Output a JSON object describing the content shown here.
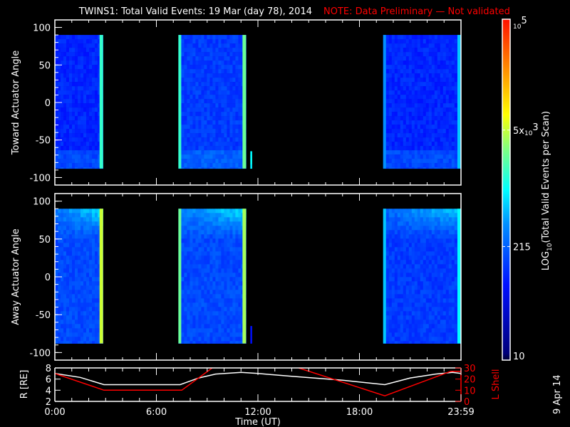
{
  "title": "TWINS1: Total Valid Events: 19 Mar (day  78), 2014",
  "note": "NOTE: Data Preliminary — Not validated",
  "date_stamp": "9 Apr 14",
  "colors": {
    "note": "#ff0000",
    "r_line": "#ffffff",
    "l_line": "#ff0000"
  },
  "chart_data": [
    {
      "type": "heatmap",
      "name": "toward",
      "ylabel": "Toward Actuator Angle",
      "ylim": [
        -110,
        110
      ],
      "yticks": [
        "100",
        "50",
        "0",
        "-50",
        "-100"
      ],
      "ytick_values": [
        100,
        50,
        0,
        -50,
        -100
      ],
      "xlim": [
        0,
        24
      ],
      "blocks": [
        {
          "t0": 0.0,
          "t1": 2.85,
          "a0": -88,
          "a1": 90,
          "level": 0.25,
          "edge_level": 0.55
        },
        {
          "t0": 7.3,
          "t1": 11.3,
          "a0": -88,
          "a1": 90,
          "level": 0.28,
          "edge_level": 0.6
        },
        {
          "t0": 11.55,
          "t1": 11.65,
          "a0": -88,
          "a1": -65,
          "level": 0.45,
          "edge_level": 0.45
        },
        {
          "t0": 19.4,
          "t1": 24.0,
          "a0": -88,
          "a1": 90,
          "level": 0.25,
          "edge_level": 0.45
        }
      ]
    },
    {
      "type": "heatmap",
      "name": "away",
      "ylabel": "Away Actuator Angle",
      "ylim": [
        -110,
        110
      ],
      "yticks": [
        "100",
        "50",
        "0",
        "-50",
        "-100"
      ],
      "ytick_values": [
        100,
        50,
        0,
        -50,
        -100
      ],
      "xlim": [
        0,
        24
      ],
      "blocks": [
        {
          "t0": 0.0,
          "t1": 2.85,
          "a0": -88,
          "a1": 90,
          "level": 0.3,
          "edge_level": 0.68
        },
        {
          "t0": 7.3,
          "t1": 11.3,
          "a0": -88,
          "a1": 90,
          "level": 0.3,
          "edge_level": 0.65
        },
        {
          "t0": 11.55,
          "t1": 11.65,
          "a0": -88,
          "a1": -65,
          "level": 0.15,
          "edge_level": 0.15
        },
        {
          "t0": 19.4,
          "t1": 24.0,
          "a0": -88,
          "a1": 90,
          "level": 0.28,
          "edge_level": 0.5
        }
      ]
    },
    {
      "type": "line",
      "name": "orbit",
      "xlabel": "Time (UT)",
      "ylabel": "R [RE]",
      "y2label": "L Shell",
      "xlim": [
        0,
        24
      ],
      "ylim": [
        2,
        8
      ],
      "y2lim": [
        0,
        30
      ],
      "xticks": [
        "0:00",
        "6:00",
        "12:00",
        "18:00",
        "23:59"
      ],
      "xtick_values": [
        0,
        6,
        12,
        18,
        24
      ],
      "yticks": [
        "8",
        "6",
        "4",
        "2"
      ],
      "ytick_values": [
        8,
        6,
        4,
        2
      ],
      "y2ticks": [
        "30",
        "20",
        "10",
        "0"
      ],
      "y2tick_values": [
        30,
        20,
        10,
        0
      ],
      "series": [
        {
          "name": "R",
          "axis": "left",
          "x": [
            0,
            1.5,
            2.9,
            7.4,
            8.5,
            9.5,
            11.0,
            12.0,
            14.0,
            17.0,
            19.5,
            21.0,
            22.5,
            23.5,
            24.0
          ],
          "y": [
            7.0,
            6.3,
            5.0,
            5.0,
            6.2,
            6.9,
            7.2,
            7.0,
            6.5,
            5.8,
            5.0,
            6.2,
            6.9,
            7.2,
            7.0
          ]
        },
        {
          "name": "L Shell",
          "axis": "right",
          "x": [
            0,
            2.9,
            7.5,
            9.3,
            null,
            14.4,
            19.5,
            23.4,
            24.0
          ],
          "y": [
            25,
            10,
            10,
            30,
            null,
            30,
            5,
            27,
            27
          ]
        }
      ]
    },
    {
      "type": "colorbar",
      "label": "LOG10(Total Valid Events per Scan)",
      "label_main": "LOG",
      "label_sub": "10",
      "label_rest": "(Total Valid Events per Scan)",
      "ticks": [
        {
          "value": 100000,
          "base": "10",
          "exp": "5",
          "prefix": ""
        },
        {
          "value": 5000,
          "base": "10",
          "exp": "3",
          "prefix": "5x"
        },
        {
          "value": 215,
          "text": "215"
        },
        {
          "value": 10,
          "text": "10"
        }
      ],
      "range": [
        10,
        100000
      ]
    }
  ]
}
